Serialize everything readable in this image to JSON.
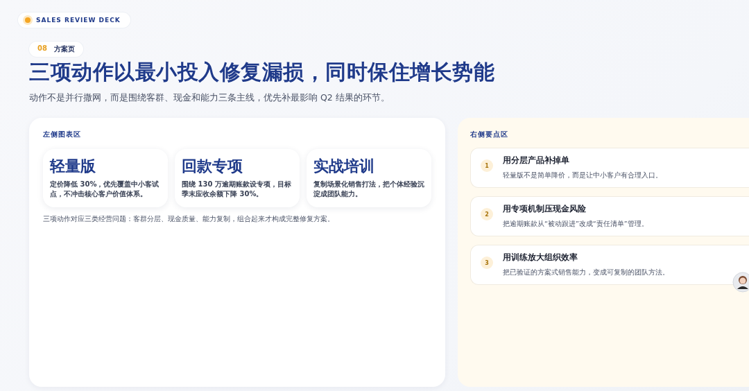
{
  "deck_badge": {
    "label": "SALES REVIEW DECK"
  },
  "page_tag": {
    "number": "08",
    "label": "方案页"
  },
  "title": "三项动作以最小投入修复漏损，同时保住增长势能",
  "subtitle": "动作不是并行撒网，而是围绕客群、现金和能力三条主线，优先补最影响 Q2 结果的环节。",
  "left_panel": {
    "heading": "左侧图表区",
    "cards": [
      {
        "title": "轻量版",
        "body": "定价降低 30%，优先覆盖中小客试点，不冲击核心客户价值体系。"
      },
      {
        "title": "回款专项",
        "body": "围绕 130 万逾期账款设专项，目标季末应收余额下降 30%。"
      },
      {
        "title": "实战培训",
        "body": "复制场景化销售打法，把个体经验沉淀成团队能力。"
      }
    ],
    "note": "三项动作对应三类经营问题：客群分层、现金质量、能力复制，组合起来才构成完整修复方案。"
  },
  "right_panel": {
    "heading": "右侧要点区",
    "points": [
      {
        "number": "1",
        "title": "用分层产品补掉单",
        "body": "轻量版不是简单降价，而是让中小客户有合理入口。"
      },
      {
        "number": "2",
        "title": "用专项机制压现金风险",
        "body": "把逾期账款从“被动跟进”改成“责任清单”管理。"
      },
      {
        "number": "3",
        "title": "用训练放大组织效率",
        "body": "把已验证的方案式销售能力，变成可复制的团队方法。"
      }
    ]
  }
}
